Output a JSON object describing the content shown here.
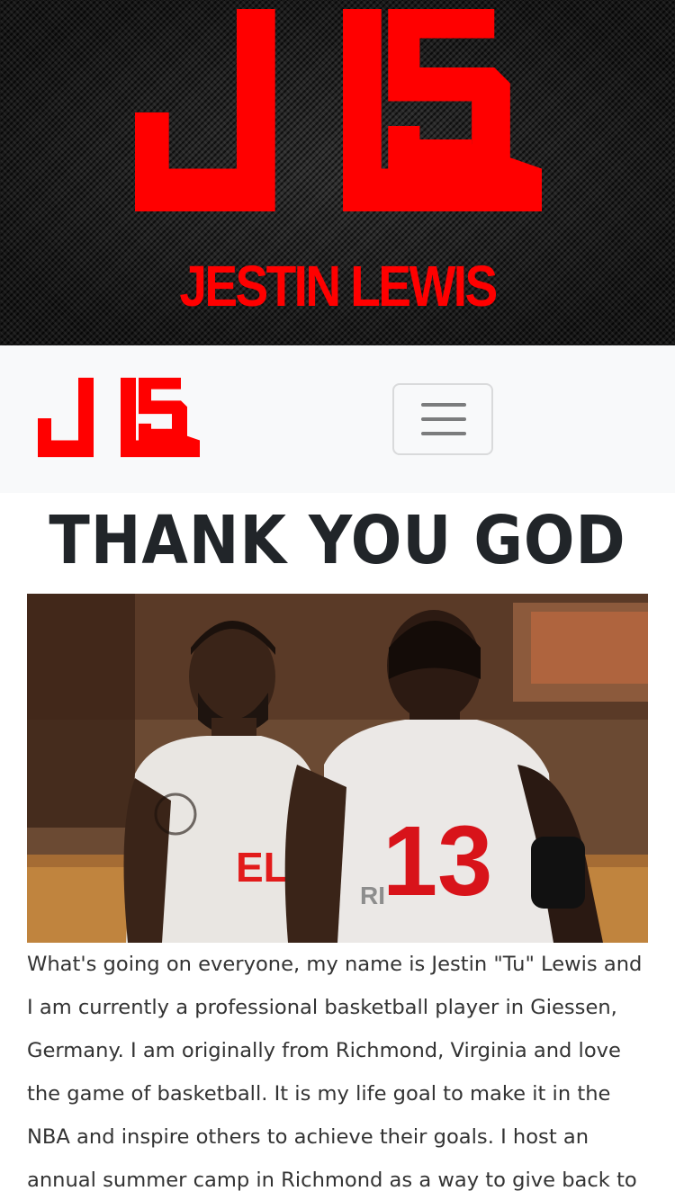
{
  "hero": {
    "logo_icon": "jl5-logo-icon",
    "name": "JESTIN LEWIS",
    "brand_color": "#ff0000"
  },
  "navbar": {
    "logo_icon": "jl5-logo-icon",
    "toggler_icon": "hamburger-menu-icon",
    "background": "#f8f9fa"
  },
  "main": {
    "title": "THANK YOU GOD",
    "photo": {
      "description_icon": "basketball-players-photo",
      "jersey_number": "13"
    },
    "bio": "What's going on everyone, my name is Jestin \"Tu\" Lewis and I am currently a professional basketball player in Giessen, Germany. I am originally from Richmond, Virginia and love the game of basketball. It is my life goal to make it in the NBA and inspire others to achieve their goals. I host an annual summer camp in Richmond as a way to give back to my"
  }
}
